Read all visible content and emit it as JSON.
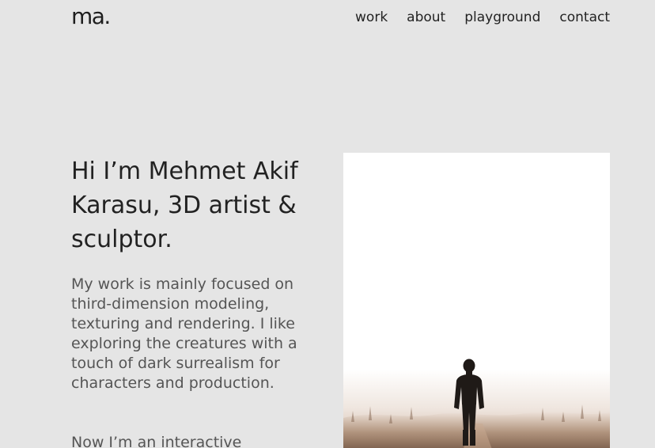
{
  "header": {
    "logo": "ma.",
    "nav": [
      "work",
      "about",
      "playground",
      "contact"
    ]
  },
  "hero": {
    "title": "Hi I’m Mehmet Akif Karasu, 3D artist & sculptor.",
    "paragraph1": "My work is mainly focused on third-dimension modeling, texturing and rendering. I like exploring the creatures with a touch of dark surrealism for characters and production.",
    "paragraph2": "Now I’m an interactive"
  },
  "image": {
    "subject": "person-walking-into-fog"
  }
}
